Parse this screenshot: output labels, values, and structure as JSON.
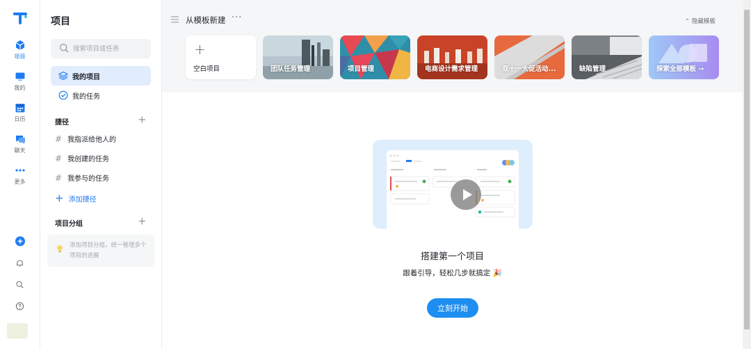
{
  "rail": {
    "items": [
      {
        "label": "项目",
        "icon": "cube-icon"
      },
      {
        "label": "我的",
        "icon": "monitor-icon"
      },
      {
        "label": "日历",
        "icon": "calendar-icon"
      },
      {
        "label": "聊天",
        "icon": "chat-icon"
      },
      {
        "label": "更多",
        "icon": "more-dots-icon"
      }
    ],
    "accent": "#1f7cf3"
  },
  "sidebar": {
    "title": "项目",
    "search_placeholder": "搜索项目或任务",
    "nav": [
      {
        "label": "我的项目",
        "icon": "layers-icon"
      },
      {
        "label": "我的任务",
        "icon": "check-circle-icon"
      }
    ],
    "shortcuts_title": "捷径",
    "shortcuts": [
      "我指派给他人的",
      "我创建的任务",
      "我参与的任务"
    ],
    "add_shortcut": "添加捷径",
    "groups_title": "项目分组",
    "groups_tip": "添加项目分组，统一管理多个项目的进展"
  },
  "templates": {
    "title": "从模板新建",
    "more": "···",
    "hide": "隐藏模板",
    "cards": [
      {
        "label": "空白项目"
      },
      {
        "label": "团队任务管理"
      },
      {
        "label": "项目管理"
      },
      {
        "label": "电商设计需求管理"
      },
      {
        "label": "双十一大促活动..."
      },
      {
        "label": "缺陷管理"
      },
      {
        "label": "探索全部模板 →"
      }
    ]
  },
  "empty_state": {
    "title": "搭建第一个项目",
    "subtitle": "跟着引导，轻松几步就搞定 🎉",
    "button": "立刻开始"
  }
}
